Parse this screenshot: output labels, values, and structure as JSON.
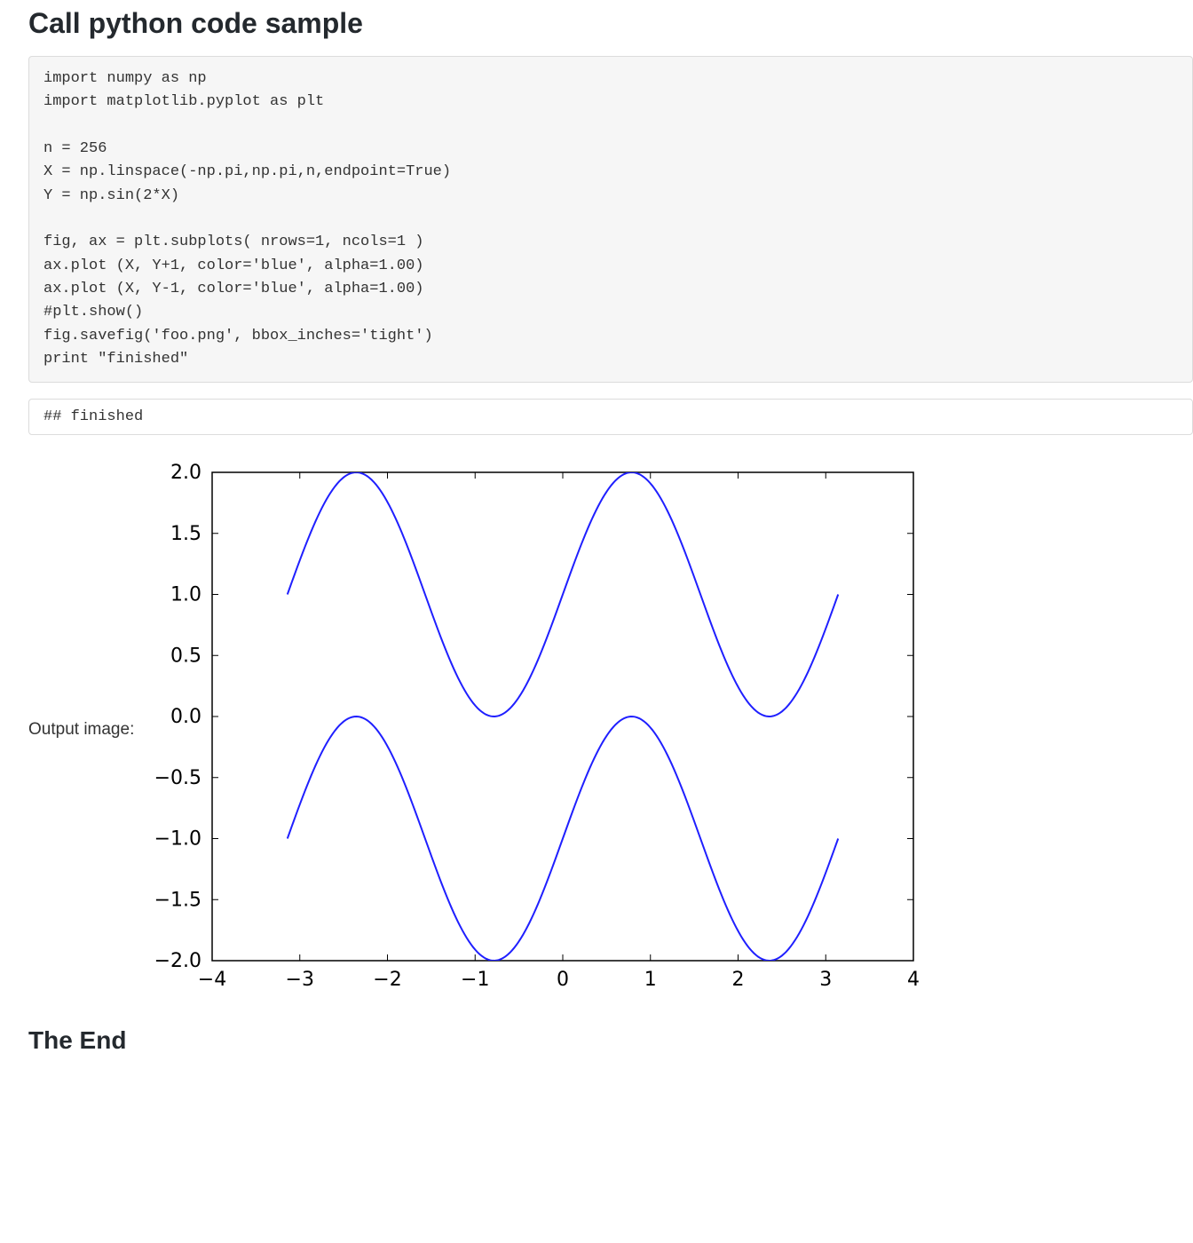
{
  "heading": "Call python code sample",
  "code": "import numpy as np\nimport matplotlib.pyplot as plt\n\nn = 256\nX = np.linspace(-np.pi,np.pi,n,endpoint=True)\nY = np.sin(2*X)\n\nfig, ax = plt.subplots( nrows=1, ncols=1 )\nax.plot (X, Y+1, color='blue', alpha=1.00)\nax.plot (X, Y-1, color='blue', alpha=1.00)\n#plt.show()\nfig.savefig('foo.png', bbox_inches='tight')\nprint \"finished\"",
  "output_text": "## finished",
  "output_image_label": "Output image:",
  "end_heading": "The End",
  "chart_data": {
    "type": "line",
    "title": "",
    "xlabel": "",
    "ylabel": "",
    "xlim": [
      -4,
      4
    ],
    "ylim": [
      -2,
      2
    ],
    "xticks": [
      -4,
      -3,
      -2,
      -1,
      0,
      1,
      2,
      3,
      4
    ],
    "yticks": [
      -2.0,
      -1.5,
      -1.0,
      -0.5,
      0.0,
      0.5,
      1.0,
      1.5,
      2.0
    ],
    "x_range": [
      -3.14159,
      3.14159
    ],
    "n_points": 256,
    "series": [
      {
        "name": "sin(2x)+1",
        "formula": "sin(2*x)+1",
        "color": "#1f1fff",
        "alpha": 1.0
      },
      {
        "name": "sin(2x)-1",
        "formula": "sin(2*x)-1",
        "color": "#1f1fff",
        "alpha": 1.0
      }
    ],
    "grid": false,
    "legend": false
  }
}
